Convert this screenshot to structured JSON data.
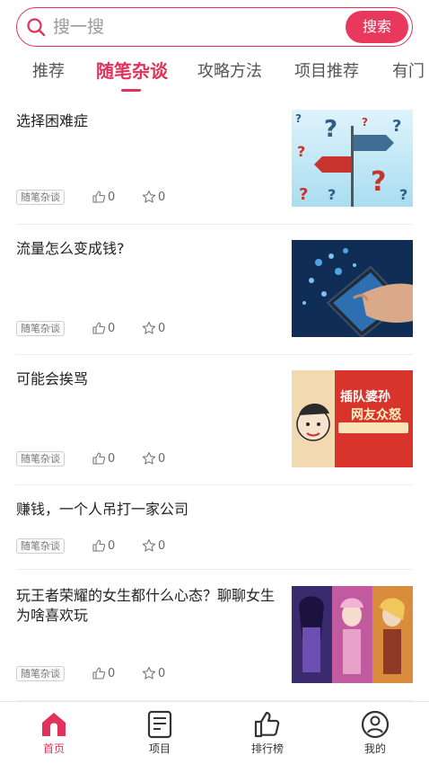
{
  "search": {
    "placeholder": "搜一搜",
    "button_label": "搜索"
  },
  "tabs": [
    {
      "label": "推荐",
      "active": false
    },
    {
      "label": "随笔杂谈",
      "active": true
    },
    {
      "label": "攻略方法",
      "active": false
    },
    {
      "label": "项目推荐",
      "active": false
    },
    {
      "label": "有门",
      "active": false
    }
  ],
  "articles": [
    {
      "title": "选择困难症",
      "tag": "随笔杂谈",
      "likes": "0",
      "favorites": "0",
      "image": "question-signpost"
    },
    {
      "title": "流量怎么变成钱?",
      "tag": "随笔杂谈",
      "likes": "0",
      "favorites": "0",
      "image": "hand-phone-icons"
    },
    {
      "title": "可能会挨骂",
      "tag": "随笔杂谈",
      "likes": "0",
      "favorites": "0",
      "image": "cartoon-banner"
    },
    {
      "title": "赚钱，一个人吊打一家公司",
      "tag": "随笔杂谈",
      "likes": "0",
      "favorites": "0",
      "image": null
    },
    {
      "title": "玩王者荣耀的女生都什么心态？聊聊女生为啥喜欢玩",
      "tag": "随笔杂谈",
      "likes": "0",
      "favorites": "0",
      "image": "game-characters"
    }
  ],
  "thumbnail_text": {
    "banner_main": "插队婆孙",
    "banner_sub": "网友众怒"
  },
  "bottom_nav": [
    {
      "label": "首页",
      "icon": "home-icon",
      "active": true
    },
    {
      "label": "项目",
      "icon": "document-icon",
      "active": false
    },
    {
      "label": "排行榜",
      "icon": "thumbs-up-icon",
      "active": false
    },
    {
      "label": "我的",
      "icon": "user-icon",
      "active": false
    }
  ],
  "colors": {
    "accent": "#e0325a",
    "text": "#222222",
    "muted": "#666666"
  }
}
